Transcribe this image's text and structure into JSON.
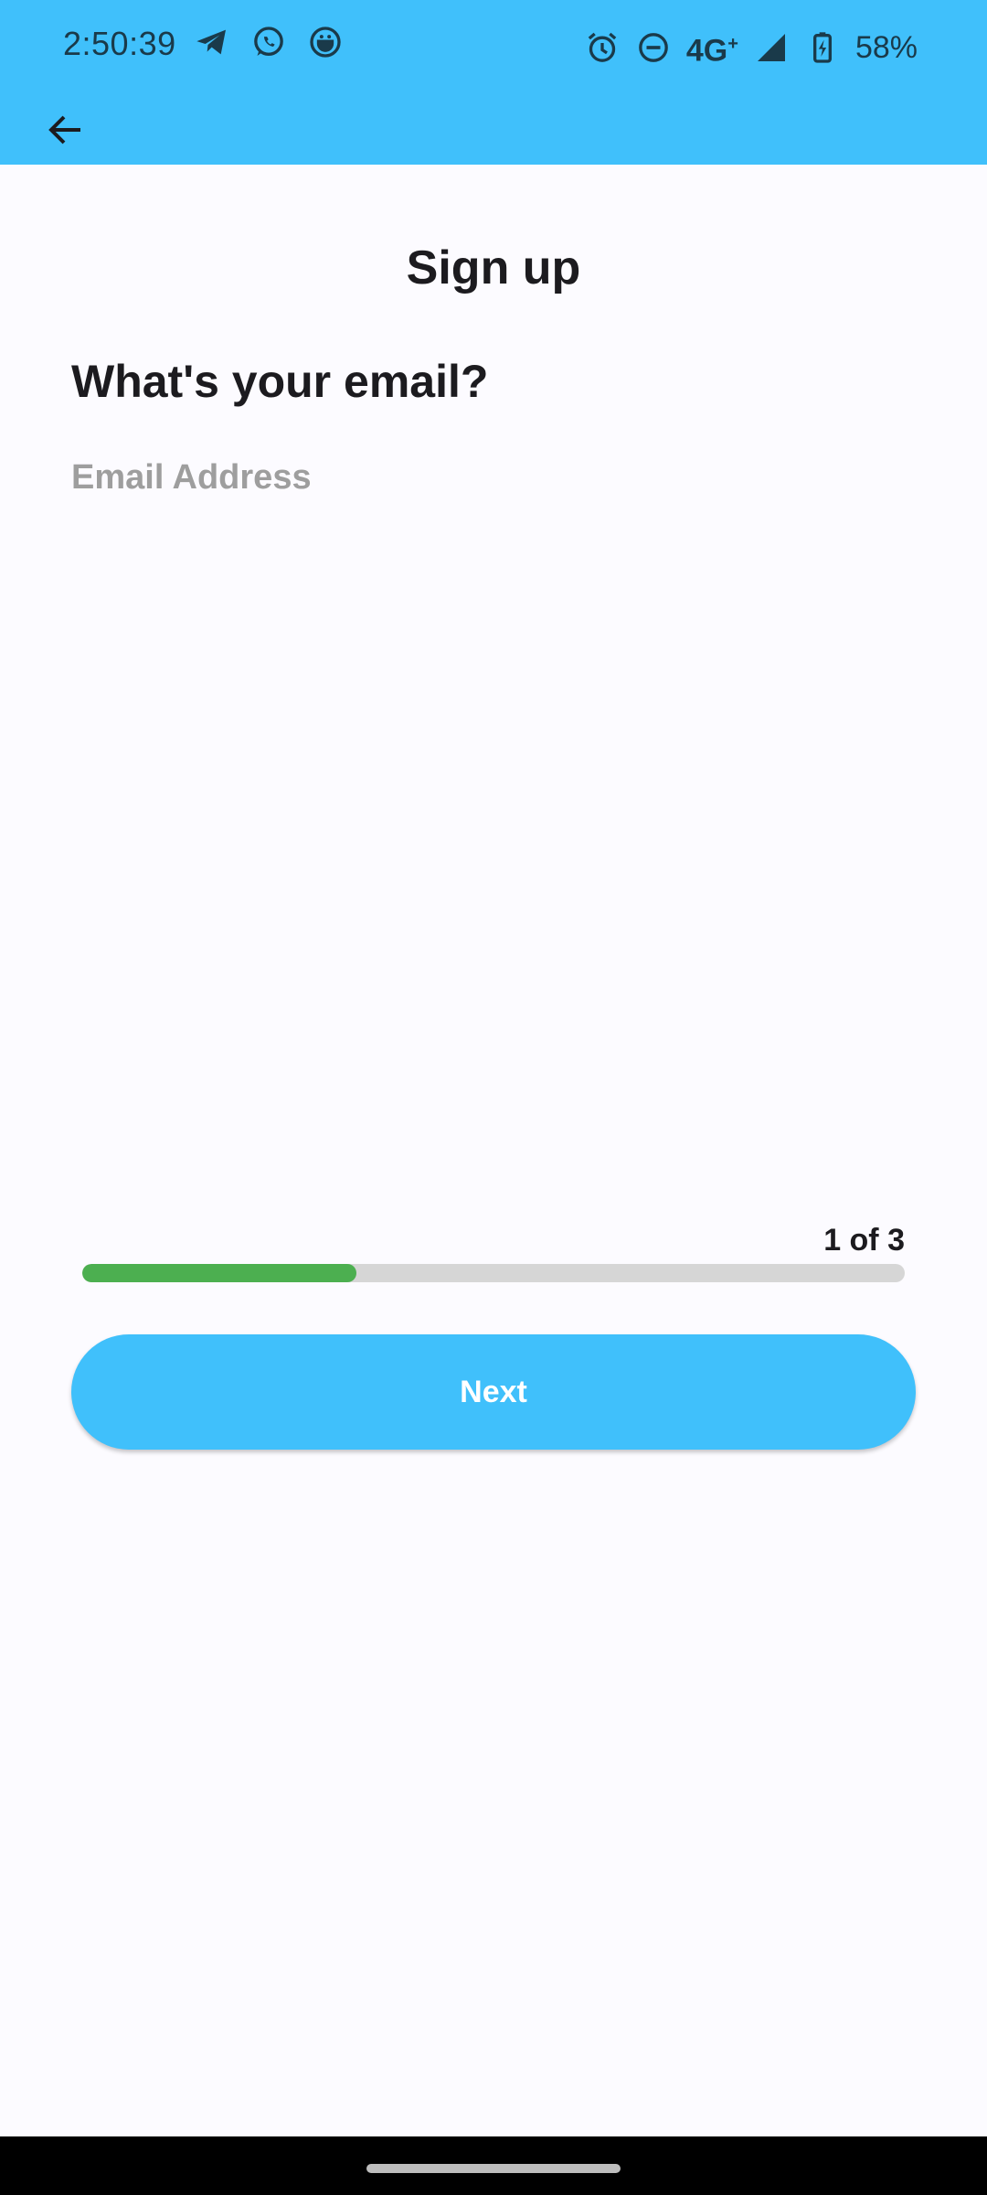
{
  "status_bar": {
    "time": "2:50:39",
    "network": "4G",
    "network_superscript": "+",
    "battery_percent": "58%",
    "left_icons": [
      "telegram-icon",
      "whatsapp-icon",
      "app-notification-icon"
    ],
    "right_icons": [
      "alarm-icon",
      "do-not-disturb-icon",
      "signal-icon",
      "battery-charging-icon"
    ]
  },
  "app_bar": {
    "back_icon": "arrow-left-icon"
  },
  "page": {
    "title": "Sign up",
    "question": "What's your email?",
    "email_placeholder": "Email Address",
    "email_value": ""
  },
  "progress": {
    "label": "1 of 3",
    "current_step": 1,
    "total_steps": 3,
    "fraction": 0.333
  },
  "actions": {
    "next_label": "Next"
  },
  "colors": {
    "accent": "#40c0fb",
    "progress_fill": "#4caf50",
    "progress_track": "#d6d6d6",
    "background": "#fcfbff"
  }
}
